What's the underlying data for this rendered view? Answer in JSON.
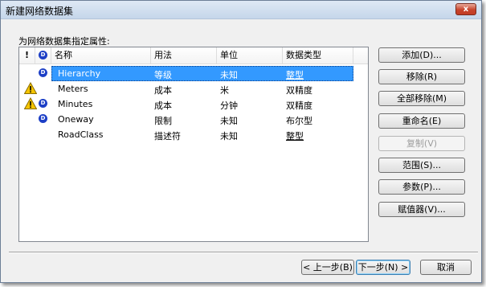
{
  "window": {
    "title": "新建网络数据集",
    "close_label": "x"
  },
  "section_label": "为网络数据集指定属性:",
  "columns": {
    "warning": "!",
    "domain": "",
    "name": "名称",
    "usage": "用法",
    "unit": "单位",
    "type": "数据类型"
  },
  "rows": [
    {
      "name": "Hierarchy",
      "usage": "等级",
      "unit": "未知",
      "type": "整型",
      "warning": false,
      "domain": true,
      "selected": true
    },
    {
      "name": "Meters",
      "usage": "成本",
      "unit": "米",
      "type": "双精度",
      "warning": true,
      "domain": false,
      "selected": false
    },
    {
      "name": "Minutes",
      "usage": "成本",
      "unit": "分钟",
      "type": "双精度",
      "warning": true,
      "domain": true,
      "selected": false
    },
    {
      "name": "Oneway",
      "usage": "限制",
      "unit": "未知",
      "type": "布尔型",
      "warning": false,
      "domain": true,
      "selected": false
    },
    {
      "name": "RoadClass",
      "usage": "描述符",
      "unit": "未知",
      "type": "整型",
      "warning": false,
      "domain": false,
      "selected": false
    }
  ],
  "buttons": {
    "add": "添加(D)...",
    "remove": "移除(R)",
    "remove_all": "全部移除(M)",
    "rename": "重命名(E)",
    "copy": "复制(V)",
    "ranges": "范围(S)...",
    "parameters": "参数(P)...",
    "evaluators": "赋值器(V)..."
  },
  "nav": {
    "back": "< 上一步(B)",
    "next": "下一步(N) >",
    "cancel": "取消"
  },
  "colors": {
    "selection": "#3399ff",
    "domain_icon": "#1d3fc6",
    "warning": "#f5c400"
  }
}
